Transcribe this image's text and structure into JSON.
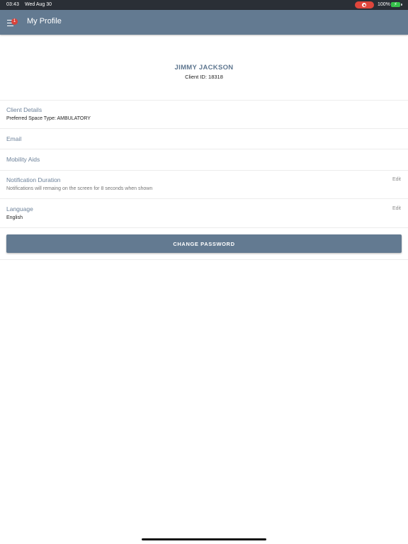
{
  "status_bar": {
    "time": "03:43",
    "date": "Wed Aug 30",
    "battery": "100%",
    "recording_color": "#e0463c",
    "battery_color": "#35c24a"
  },
  "nav": {
    "title": "My Profile",
    "menu_badge": "1",
    "bar_color": "#637a91"
  },
  "profile": {
    "name": "JIMMY JACKSON",
    "client_id_label": "Client ID:",
    "client_id": "18318"
  },
  "rows": {
    "client_details": {
      "label": "Client Details",
      "value": "Preferred Space Type: AMBULATORY"
    },
    "email": {
      "label": "Email"
    },
    "mobility_aids": {
      "label": "Mobility Aids"
    },
    "notification_duration": {
      "label": "Notification Duration",
      "value": "Notifications will remaing on the screen for 8 seconds when shown",
      "edit": "Edit"
    },
    "language": {
      "label": "Language",
      "value": "English",
      "edit": "Edit"
    }
  },
  "actions": {
    "change_password": "CHANGE PASSWORD"
  }
}
